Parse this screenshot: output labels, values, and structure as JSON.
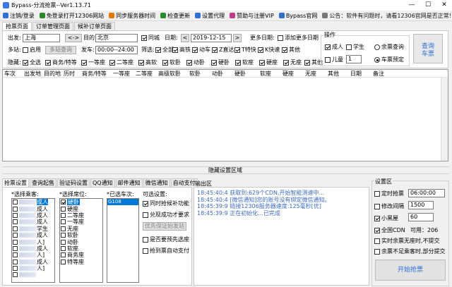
{
  "window": {
    "title": "Bypass-分流抢票--Ver1.13.71",
    "min": "—",
    "max": "☐",
    "close": "✕"
  },
  "toolbar": {
    "items": [
      "注销/登录",
      "免登录打开12306网站",
      "同步服务器时间",
      "检查更新",
      "设置代理",
      "赞助与注册VIP",
      "Bypass官网"
    ],
    "icon_colors": [
      "#2f6fd1",
      "#2a8a2a",
      "#e07b00",
      "#2a8a2a",
      "#2f6fd1",
      "#c03a8a",
      "#2f6fd1"
    ],
    "notice": "公告：软件有问题时，请看12306官网是否正常!"
  },
  "tabs": [
    "抢票页面",
    "订单管理页面",
    "候补订单页面"
  ],
  "search": {
    "from_label": "出发:",
    "from_value": "上海",
    "swap_label": "<->",
    "to_label": "目的:",
    "to_value": "北京",
    "same_city_label": "同城",
    "date_label": "日期:",
    "prev": "<",
    "date_value": "2019-12-15",
    "next": ">",
    "more_dates_label": "更多日期:",
    "add_dates_label": "添加更多日期",
    "multistation_label": "多站:",
    "enable_label": "启用",
    "multistation_btn": "多站查询",
    "depart_label": "发车:",
    "depart_value": "00:00--24:00",
    "filter_label": "筛选:",
    "train_types": [
      "全部",
      "高铁",
      "动车",
      "Z直达",
      "T特快",
      "K快速",
      "其他"
    ],
    "hide_label": "隐藏:",
    "seat_types": [
      "全选",
      "商务/特等",
      "一等座",
      "二等座",
      "高软",
      "软卧",
      "动卧",
      "硬卧",
      "软座",
      "硬座",
      "无座",
      "其他"
    ],
    "ops_title": "操作",
    "adult": "成人",
    "student": "学生",
    "child": "儿童",
    "child_count": "1",
    "remain_query": "余票查询",
    "booking": "车票预定",
    "query_btn": [
      "查询",
      "车票"
    ]
  },
  "grid": {
    "columns": [
      "车次",
      "出发地",
      "目的地",
      "历时",
      "商务/特等",
      "一等座",
      "二等座",
      "高级软卧",
      "软卧",
      "动卧",
      "硬卧",
      "软座",
      "硬座",
      "无座",
      "其他",
      "日期",
      "备注"
    ]
  },
  "splitter": "隐藏设置区域",
  "bottom_tabs": [
    "抢票设置",
    "查询起售",
    "验证码设置",
    "QQ通知",
    "邮件通知",
    "微信通知",
    "自动支付"
  ],
  "passengers": {
    "title": "*选择乘客:",
    "items": [
      {
        "tag": "成人",
        "checked": false,
        "selected": true
      },
      {
        "tag": "成人",
        "checked": false,
        "selected": false
      },
      {
        "tag": "成人",
        "checked": false,
        "selected": false
      },
      {
        "tag": "成人",
        "checked": false,
        "selected": false
      },
      {
        "tag": "学生",
        "checked": false,
        "selected": false
      },
      {
        "tag": "成人",
        "checked": false,
        "selected": false
      },
      {
        "tag": "人]",
        "checked": false,
        "selected": false
      },
      {
        "tag": "成人",
        "checked": false,
        "selected": false
      },
      {
        "tag": "人]",
        "checked": false,
        "selected": false
      },
      {
        "tag": "成人",
        "checked": false,
        "selected": false
      },
      {
        "tag": "人]",
        "checked": false,
        "selected": false
      },
      {
        "tag": "",
        "checked": false,
        "selected": false
      }
    ]
  },
  "seats": {
    "title": "*选择席位:",
    "items": [
      {
        "label": "硬卧",
        "checked": true,
        "selected": true
      },
      {
        "label": "硬座",
        "checked": false,
        "selected": false
      },
      {
        "label": "二等座",
        "checked": false,
        "selected": false
      },
      {
        "label": "一等座",
        "checked": false,
        "selected": false
      },
      {
        "label": "无座",
        "checked": false,
        "selected": false
      },
      {
        "label": "软卧",
        "checked": false,
        "selected": false
      },
      {
        "label": "动卧",
        "checked": false,
        "selected": false
      },
      {
        "label": "软座",
        "checked": false,
        "selected": false
      },
      {
        "label": "商务座",
        "checked": false,
        "selected": false
      },
      {
        "label": "特等座",
        "checked": false,
        "selected": false
      }
    ]
  },
  "trains": {
    "title": "*已选车次:",
    "items": [
      "G108"
    ]
  },
  "options": {
    "title": "可选设置:",
    "sync_waitlist": "同时抢候补功能",
    "manual_confirm": "兑现成功才要求",
    "priority_btn": "优先保证始发站",
    "preselect": "是否要预先选座",
    "auto_pay": "抢到票自动支付"
  },
  "log": {
    "title": "输出区",
    "lines": [
      {
        "time": "18:45:40:4",
        "text": "获取到:629个CDN,开始智能测速中..."
      },
      {
        "time": "18:45:40:4",
        "text": "[微信通知]您的账号没有绑定微信通知。"
      },
      {
        "time": "18:45:39:9",
        "text": "链接12306服务器速度:125毫秒[优]"
      },
      {
        "time": "18:45:39:9",
        "text": "正在初始化...已完成"
      }
    ]
  },
  "settings": {
    "title": "设置区",
    "timed_label": "定时抢票",
    "timed_value": "06:00:00",
    "interval_label": "修改间隔",
    "interval_value": "1500",
    "blackroom_label": "小黑屋",
    "blackroom_value": "60",
    "cdn_label": "全国CDN",
    "cdn_usable": "可用：206",
    "realtime_label": "实时余票无座时,不提交",
    "partial_label": "余票不足乘客时,部分提交",
    "start_btn": "开始抢票"
  }
}
